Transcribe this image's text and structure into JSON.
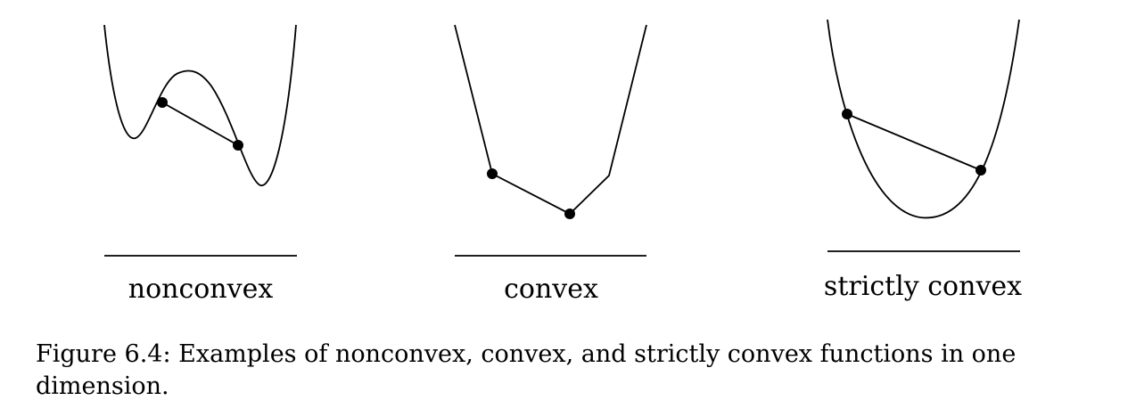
{
  "panels": [
    {
      "id": "nonconvex",
      "label": "nonconvex"
    },
    {
      "id": "convex",
      "label": "convex"
    },
    {
      "id": "strictly_convex",
      "label": "strictly convex"
    }
  ],
  "caption": {
    "prefix": "Figure 6.4:",
    "text": "Examples of nonconvex, convex, and strictly convex functions in one dimension."
  },
  "colors": {
    "ink": "#000000",
    "background": "#ffffff"
  }
}
